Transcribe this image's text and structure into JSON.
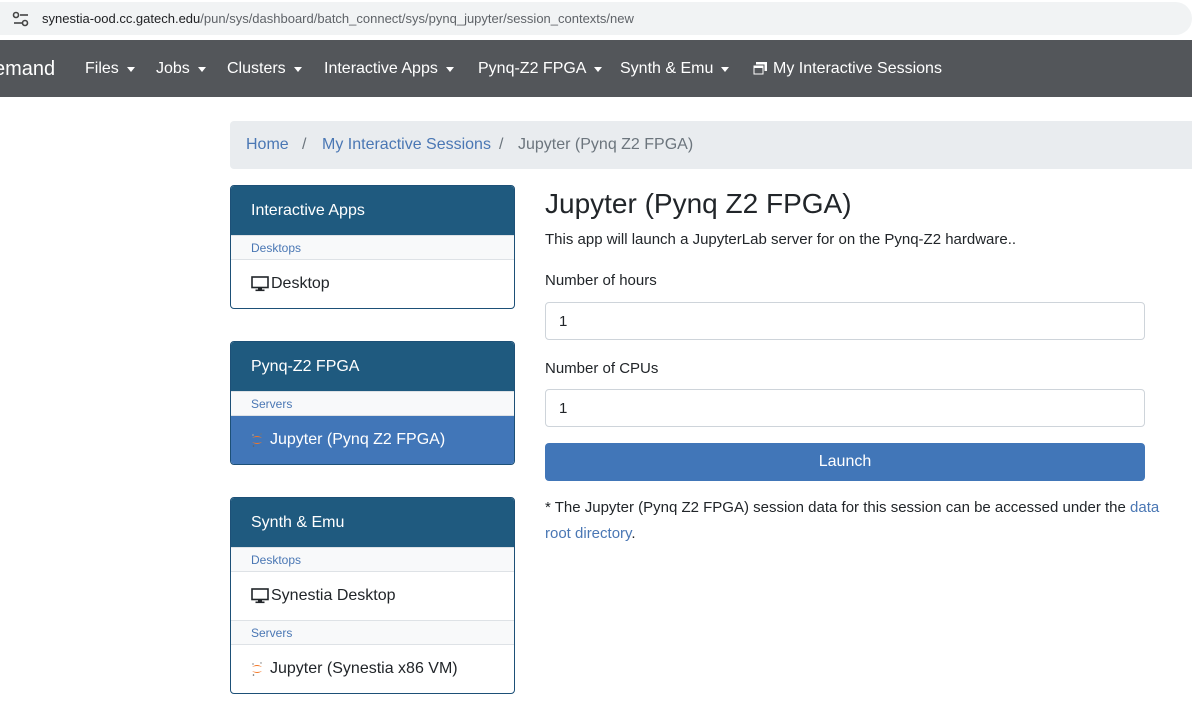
{
  "browser": {
    "url_host": "synestia-ood.cc.gatech.edu",
    "url_path": "/pun/sys/dashboard/batch_connect/sys/pynq_jupyter/session_contexts/new"
  },
  "navbar": {
    "brand": "emand",
    "items": [
      {
        "label": "Files"
      },
      {
        "label": "Jobs"
      },
      {
        "label": "Clusters"
      },
      {
        "label": "Interactive Apps"
      },
      {
        "label": "Pynq-Z2 FPGA"
      },
      {
        "label": "Synth & Emu"
      }
    ],
    "sessions_label": "My Interactive Sessions"
  },
  "breadcrumb": {
    "home": "Home",
    "sep": "/",
    "sessions": "My Interactive Sessions",
    "current": "Jupyter (Pynq Z2 FPGA)"
  },
  "panels": [
    {
      "title": "Interactive Apps",
      "groups": [
        {
          "category": "Desktops",
          "items": [
            {
              "label": "Desktop",
              "icon": "monitor-icon"
            }
          ]
        }
      ]
    },
    {
      "title": "Pynq-Z2 FPGA",
      "groups": [
        {
          "category": "Servers",
          "items": [
            {
              "label": "Jupyter (Pynq Z2 FPGA)",
              "icon": "jupyter-icon",
              "active": true
            }
          ]
        }
      ]
    },
    {
      "title": "Synth & Emu",
      "groups": [
        {
          "category": "Desktops",
          "items": [
            {
              "label": "Synestia Desktop",
              "icon": "monitor-icon"
            }
          ]
        },
        {
          "category": "Servers",
          "items": [
            {
              "label": "Jupyter (Synestia x86 VM)",
              "icon": "jupyter-icon"
            }
          ]
        }
      ]
    }
  ],
  "main": {
    "title": "Jupyter (Pynq Z2 FPGA)",
    "description": "This app will launch a JupyterLab server for on the Pynq-Z2 hardware..",
    "hours_label": "Number of hours",
    "hours_value": "1",
    "cpus_label": "Number of CPUs",
    "cpus_value": "1",
    "launch_label": "Launch",
    "note_text": "* The Jupyter (Pynq Z2 FPGA) session data for this session can be accessed under the",
    "note_link": "data root directory",
    "note_end": "."
  },
  "colors": {
    "navbar": "#53565a",
    "panel_header": "#1f5a7f",
    "active_item": "#4176b8",
    "link": "#4a77b4",
    "button": "#4176b8"
  }
}
